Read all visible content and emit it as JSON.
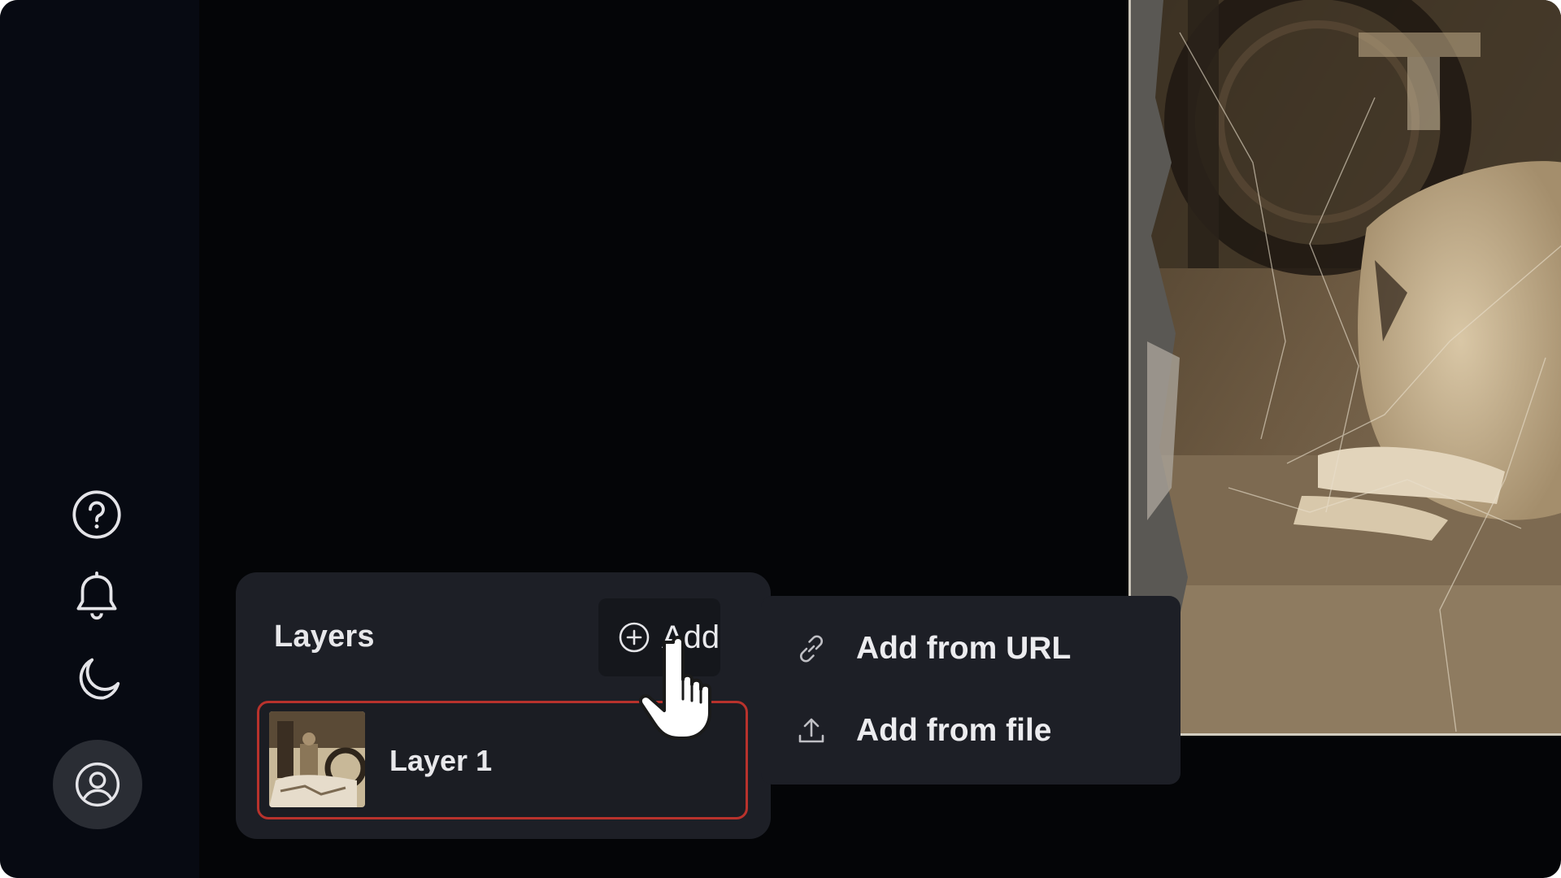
{
  "sidebar": {
    "buttons": [
      {
        "name": "help",
        "icon": "help-circle-icon"
      },
      {
        "name": "notifications",
        "icon": "bell-icon"
      },
      {
        "name": "dark-mode",
        "icon": "moon-icon"
      },
      {
        "name": "account",
        "icon": "user-circle-icon",
        "active": true
      }
    ]
  },
  "layers_panel": {
    "title": "Layers",
    "add_button": {
      "label": "Add",
      "icon": "plus-circle-icon"
    },
    "layers": [
      {
        "name": "Layer 1",
        "selected": true,
        "selected_border_color": "#b8322c"
      }
    ]
  },
  "add_menu": {
    "items": [
      {
        "label": "Add from URL",
        "icon": "link-icon"
      },
      {
        "label": "Add from file",
        "icon": "upload-icon"
      }
    ]
  },
  "canvas": {
    "image": "sepia vintage photograph"
  },
  "colors": {
    "background": "#040507",
    "sidebar": "#070a12",
    "panel": "#1d1f26",
    "accent_selected": "#b8322c"
  },
  "cursor": {
    "icon": "hand-pointer-icon"
  }
}
